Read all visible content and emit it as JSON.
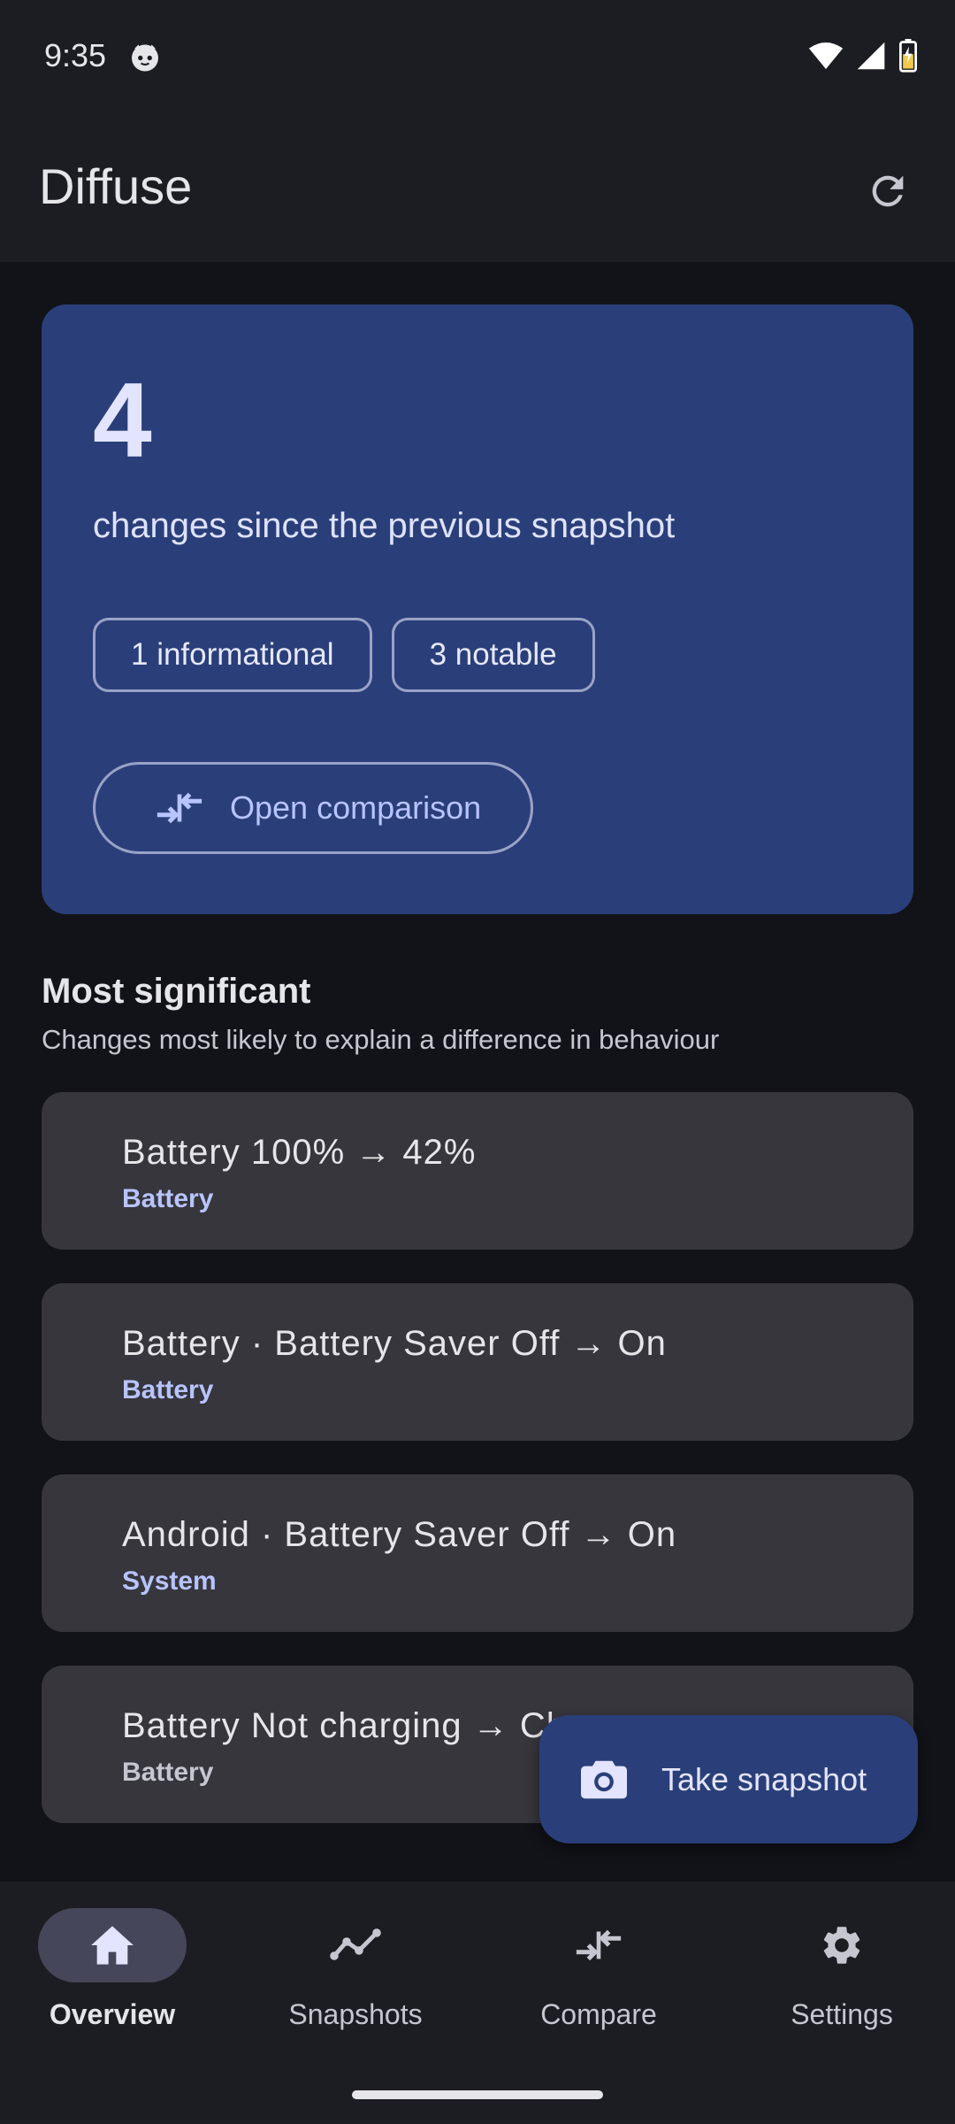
{
  "status_bar": {
    "time": "9:35",
    "icons": [
      "cat-notification-icon",
      "wifi-icon",
      "signal-icon",
      "battery-charging-icon"
    ]
  },
  "app_bar": {
    "title": "Diffuse",
    "action_icon": "refresh-icon"
  },
  "summary": {
    "count": "4",
    "description": "changes since the previous snapshot",
    "chips": [
      "1 informational",
      "3 notable"
    ],
    "compare_button": "Open comparison"
  },
  "section": {
    "title": "Most significant",
    "subtitle": "Changes most likely to explain a difference in behaviour"
  },
  "changes": [
    {
      "title": "Battery 100% → 42%",
      "category": "Battery"
    },
    {
      "title": "Battery · Battery Saver Off → On",
      "category": "Battery"
    },
    {
      "title": "Android · Battery Saver Off → On",
      "category": "System"
    },
    {
      "title": "Battery Not charging → Cha",
      "category": "Battery"
    }
  ],
  "fab": {
    "label": "Take snapshot",
    "icon": "camera-icon"
  },
  "bottom_nav": {
    "items": [
      {
        "label": "Overview",
        "icon": "home-icon",
        "active": true
      },
      {
        "label": "Snapshots",
        "icon": "timeline-icon",
        "active": false
      },
      {
        "label": "Compare",
        "icon": "compare-arrows-icon",
        "active": false
      },
      {
        "label": "Settings",
        "icon": "gear-icon",
        "active": false
      }
    ]
  },
  "colors": {
    "background": "#121318",
    "surface": "#1c1d22",
    "hero_card": "#2a3f79",
    "list_card": "#36363c",
    "accent_text": "#b8c4ff"
  }
}
